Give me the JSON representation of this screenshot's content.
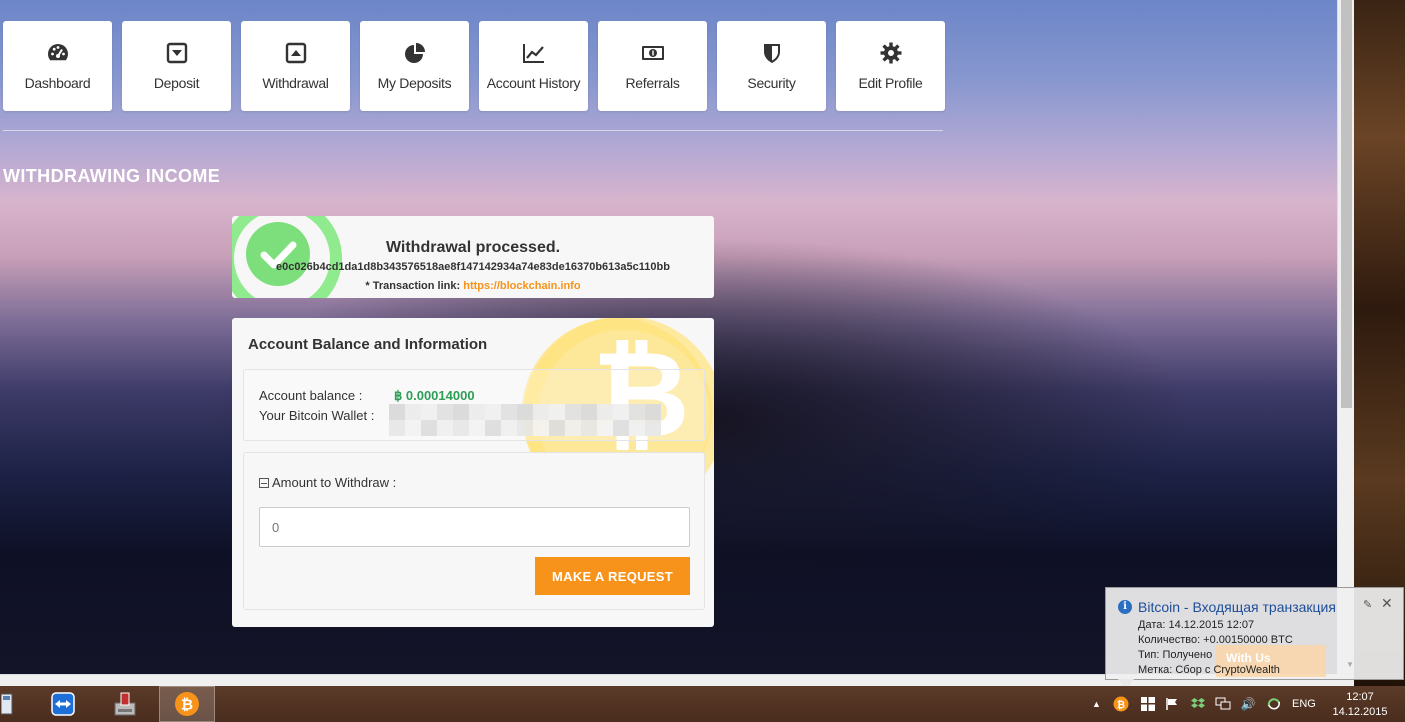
{
  "nav": {
    "items": [
      {
        "label": "Dashboard",
        "icon": "dashboard-gauge-icon"
      },
      {
        "label": "Deposit",
        "icon": "deposit-download-icon"
      },
      {
        "label": "Withdrawal",
        "icon": "withdrawal-upload-icon"
      },
      {
        "label": "My Deposits",
        "icon": "pie-chart-icon"
      },
      {
        "label": "Account History",
        "icon": "line-chart-icon"
      },
      {
        "label": "Referrals",
        "icon": "money-bill-icon"
      },
      {
        "label": "Security",
        "icon": "shield-icon"
      },
      {
        "label": "Edit Profile",
        "icon": "gear-icon"
      }
    ]
  },
  "section_title": "WITHDRAWING INCOME",
  "success": {
    "heading": "Withdrawal processed.",
    "txid": "e0c026b4cd1da1d8b343576518ae8f147142934a74e83de16370b613a5c110bb",
    "link_prefix": "* Transaction link: ",
    "link_text": "https://blockchain.info"
  },
  "balance": {
    "title": "Account Balance and Information",
    "balance_label": "Account balance :",
    "balance_value": "฿ 0.00014000",
    "wallet_label": "Your Bitcoin Wallet :",
    "amount_label": "Amount to Withdraw :",
    "amount_placeholder": "0",
    "button_label": "MAKE A REQUEST"
  },
  "notification": {
    "title": "Bitcoin - Входящая транзакция",
    "date": "Дата: 14.12.2015 12:07",
    "amount": "Количество: +0.00150000 BTC",
    "type": "Тип: Получено",
    "label": "Метка: Сбор с CryptoWealth",
    "ghost_text": "With Us"
  },
  "taskbar": {
    "lang": "ENG",
    "time": "12:07",
    "date": "14.12.2015"
  },
  "colors": {
    "accent": "#f7931a",
    "balance_green": "#2e9e57",
    "success_green": "#7ddf7b",
    "notify_title": "#1f4e99"
  }
}
